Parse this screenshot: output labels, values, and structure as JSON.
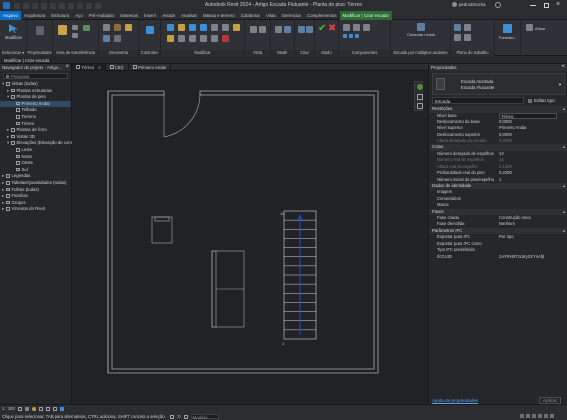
{
  "titlebar": {
    "title": "Autodesk Revit 2024 - Artigo Escada Flutuante - Planta de piso: Térreo",
    "user": "pedro20rocha"
  },
  "ribbon_tabs": [
    "Arquivo",
    "Arquitetura",
    "Estrutura",
    "Aço",
    "Pré-moldado",
    "Sistemas",
    "Inserir",
    "Anotar",
    "Analisar",
    "Massa e terreno",
    "Colaborar",
    "Vista",
    "Gerenciar",
    "Complementos"
  ],
  "context_tab": "Modificar | Criar escada",
  "ribbon_panels": {
    "modify": "Modificar",
    "select": "Selecionar ▾",
    "properties": "Propriedades",
    "clipboard": "Área de transferência",
    "geometry": "Geometria",
    "controls": "Controles",
    "modify2": "Modificar",
    "view": "Vista",
    "measure": "Medir",
    "create": "Criar",
    "mode": "Modo",
    "components": "Componentes",
    "multistory": "Escada por múltiplos andares",
    "workplane": "Plano de trabalho",
    "connect_levels": "Conectar níveis",
    "forma": "Formato...",
    "attach": "Afixar"
  },
  "optionsbar": {
    "label": "Modificar | Criar escada"
  },
  "browser": {
    "title": "Navegador de projeto - Artigo...",
    "search_placeholder": "Pesquisar",
    "items": [
      {
        "label": "Vistas (todas)",
        "level": 0,
        "open": true
      },
      {
        "label": "Plantas estruturais",
        "level": 1,
        "open": false
      },
      {
        "label": "Plantas de piso",
        "level": 1,
        "open": true
      },
      {
        "label": "Primeiro Andar",
        "level": 2,
        "open": null
      },
      {
        "label": "Telhado",
        "level": 2,
        "open": null
      },
      {
        "label": "Terreno",
        "level": 2,
        "open": null
      },
      {
        "label": "Térreo",
        "level": 2,
        "open": null
      },
      {
        "label": "Plantas de forro",
        "level": 1,
        "open": false
      },
      {
        "label": "Vistas 3D",
        "level": 1,
        "open": false
      },
      {
        "label": "Elevações (Elevação de constr",
        "level": 1,
        "open": true
      },
      {
        "label": "Leste",
        "level": 2,
        "open": null
      },
      {
        "label": "Norte",
        "level": 2,
        "open": null
      },
      {
        "label": "Oeste",
        "level": 2,
        "open": null
      },
      {
        "label": "Sul",
        "level": 2,
        "open": null
      },
      {
        "label": "Legendas",
        "level": 0,
        "open": false
      },
      {
        "label": "Tabelas/Quantidades (todas)",
        "level": 0,
        "open": false
      },
      {
        "label": "Folhas (todas)",
        "level": 0,
        "open": false
      },
      {
        "label": "Famílias",
        "level": 0,
        "open": false
      },
      {
        "label": "Grupos",
        "level": 0,
        "open": false
      },
      {
        "label": "Vínculos do Revit",
        "level": 0,
        "open": false
      }
    ]
  },
  "view_tabs": [
    "Térreo",
    "{3D}",
    "Primeiro Andar"
  ],
  "properties": {
    "title": "Propriedades",
    "type_line1": "Escada montada",
    "type_line2": "Escada Flutuante",
    "selector": "Escada",
    "edit_type": "Editar tipo",
    "sections": [
      {
        "name": "Restrições",
        "rows": [
          {
            "k": "Nível base",
            "v": "Térreo",
            "dim": false,
            "box": true
          },
          {
            "k": "Deslocamento da base",
            "v": "0,0000",
            "dim": false
          },
          {
            "k": "Nível superior",
            "v": "Primeiro Andar",
            "dim": false
          },
          {
            "k": "Deslocamento superior",
            "v": "0,0000",
            "dim": false
          },
          {
            "k": "Altura desejada da escada",
            "v": "2,0000",
            "dim": true
          }
        ]
      },
      {
        "name": "Cotas",
        "rows": [
          {
            "k": "Número desejado de espelhos",
            "v": "14",
            "dim": false
          },
          {
            "k": "Número real de espelhos",
            "v": "14",
            "dim": true
          },
          {
            "k": "Altura real do espelho",
            "v": "0,1429",
            "dim": true
          },
          {
            "k": "Profundidade real do piso",
            "v": "0,2200",
            "dim": false
          },
          {
            "k": "Número inicial do piso/espelho",
            "v": "1",
            "dim": false
          }
        ]
      },
      {
        "name": "Dados de identidade",
        "rows": [
          {
            "k": "Imagem",
            "v": "",
            "dim": false
          },
          {
            "k": "Comentários",
            "v": "",
            "dim": false
          },
          {
            "k": "Marca",
            "v": "",
            "dim": false
          }
        ]
      },
      {
        "name": "Fases",
        "rows": [
          {
            "k": "Fase criada",
            "v": "Construção nova",
            "dim": false
          },
          {
            "k": "Fase demolida",
            "v": "Nenhum",
            "dim": false
          }
        ]
      },
      {
        "name": "Parâmetros IFC",
        "rows": [
          {
            "k": "Exportar para IFC",
            "v": "Por tipo",
            "dim": false
          },
          {
            "k": "Exportar para IFC como",
            "v": "",
            "dim": false
          },
          {
            "k": "Tipo IFC predefinido",
            "v": "",
            "dim": false
          },
          {
            "k": "IfcGUID",
            "v": "2AYRH9TJL9ry2XYnAfjt",
            "dim": false
          }
        ]
      }
    ],
    "help_link": "Ajuda de propriedades",
    "apply": "Aplicar"
  },
  "canvas": {
    "scale": "1 : 100",
    "stair_top_label": "14",
    "stair_bottom_label": "1"
  },
  "statusbar": {
    "message": "Clique para selecionar, TAB para alternativas, CTRL adiciona, SHIFT cancela a seleção.",
    "model": "Modelo principal",
    "zoom": ":0"
  },
  "colors": {
    "accent": "#0b6cc4",
    "context_tab": "#2e6a34",
    "background": "#1e1f22",
    "stair_blue": "#1e4fd8"
  }
}
